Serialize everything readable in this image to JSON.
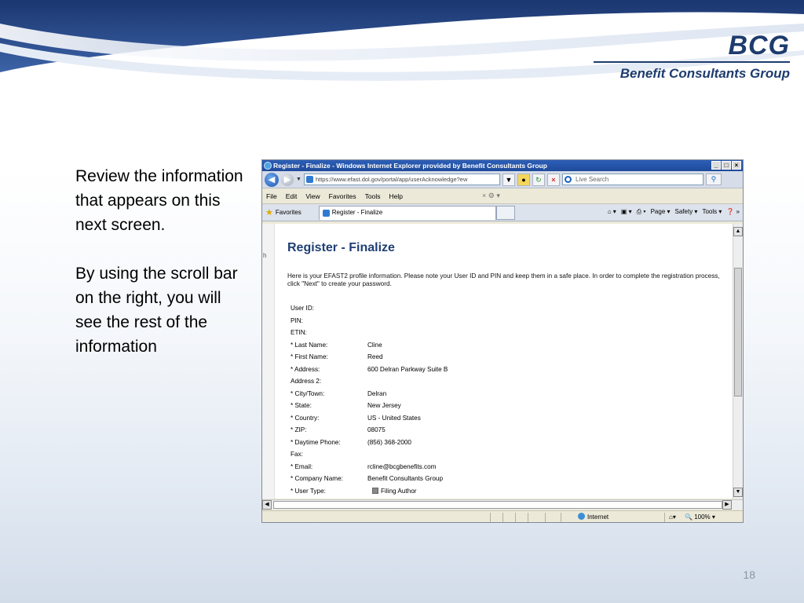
{
  "logo": {
    "mark": "BCG",
    "name": "Benefit Consultants Group"
  },
  "slide_text": {
    "paragraph1": "Review the information that appears on this next screen.",
    "paragraph2": "By using the scroll bar on the right, you will see the rest of the information"
  },
  "page_number": "18",
  "browser": {
    "title": "Register - Finalize - Windows Internet Explorer provided by Benefit Consultants Group",
    "window_buttons": [
      "_",
      "&#9633;",
      "×"
    ],
    "url": "https://www.efast.dol.gov/portal/app/userAcknowledge?ew",
    "search_placeholder": "Live Search",
    "menu": [
      "File",
      "Edit",
      "View",
      "Favorites",
      "Tools",
      "Help"
    ],
    "favorites_label": "Favorites",
    "tab_label": "Register - Finalize",
    "commands": [
      "Page ▾",
      "Safety ▾",
      "Tools ▾"
    ],
    "status_zone": "Internet",
    "zoom": "100%"
  },
  "content": {
    "left_pane_char": "h",
    "title": "Register - Finalize",
    "intro": "Here is your EFAST2 profile information. Please note your User ID and PIN and keep them in a safe place. In order to complete the registration process, click \"Next\" to create your password.",
    "fields": [
      {
        "label": "User ID:",
        "value": ""
      },
      {
        "label": "PIN:",
        "value": ""
      },
      {
        "label": "ETIN:",
        "value": ""
      },
      {
        "label": "* Last Name:",
        "value": "Cline"
      },
      {
        "label": "* First Name:",
        "value": "Reed"
      },
      {
        "label": "* Address:",
        "value": "600 Delran Parkway Suite B"
      },
      {
        "label": "Address 2:",
        "value": ""
      },
      {
        "label": "* City/Town:",
        "value": "Delran"
      },
      {
        "label": "* State:",
        "value": "New Jersey"
      },
      {
        "label": "* Country:",
        "value": "US - United States"
      },
      {
        "label": "* ZIP:",
        "value": "08075"
      },
      {
        "label": "* Daytime Phone:",
        "value": "(856) 368-2000"
      },
      {
        "label": "Fax:",
        "value": ""
      },
      {
        "label": "* Email:",
        "value": "rcline@bcgbenefits.com"
      },
      {
        "label": "* Company Name:",
        "value": "Benefit Consultants Group"
      }
    ],
    "user_type_label": "* User Type:",
    "user_type_value": "Filing Author"
  },
  "colors": {
    "brand": "#1d3c6e",
    "title_bar": "#1e4a9a",
    "page_title": "#1f3f73"
  }
}
